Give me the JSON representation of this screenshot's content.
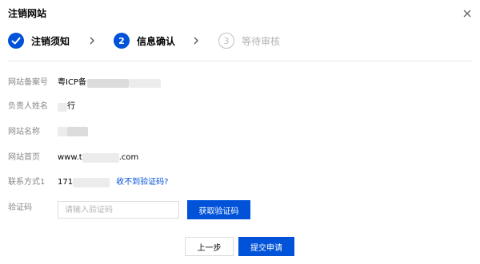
{
  "dialog": {
    "title": "注销网站",
    "close_icon": "close-icon"
  },
  "steps": [
    {
      "number": "1",
      "label": "注销须知",
      "state": "done"
    },
    {
      "number": "2",
      "label": "信息确认",
      "state": "active"
    },
    {
      "number": "3",
      "label": "等待审核",
      "state": "pending"
    }
  ],
  "form": {
    "icp_label": "网站备案号",
    "icp_value_prefix": "粤ICP备",
    "owner_label": "负责人姓名",
    "owner_value_suffix": "行",
    "name_label": "网站名称",
    "homepage_label": "网站首页",
    "homepage_prefix": "www.t",
    "homepage_suffix": ".com",
    "contact_label": "联系方式1",
    "contact_prefix": "171",
    "no_code_link": "收不到验证码?",
    "code_label": "验证码",
    "code_placeholder": "请输入验证码",
    "code_value": "",
    "get_code_button": "获取验证码"
  },
  "footer": {
    "prev_button": "上一步",
    "submit_button": "提交申请"
  },
  "colors": {
    "primary": "#0052d9",
    "label_gray": "#888888",
    "pending_gray": "#bfbfbf"
  }
}
